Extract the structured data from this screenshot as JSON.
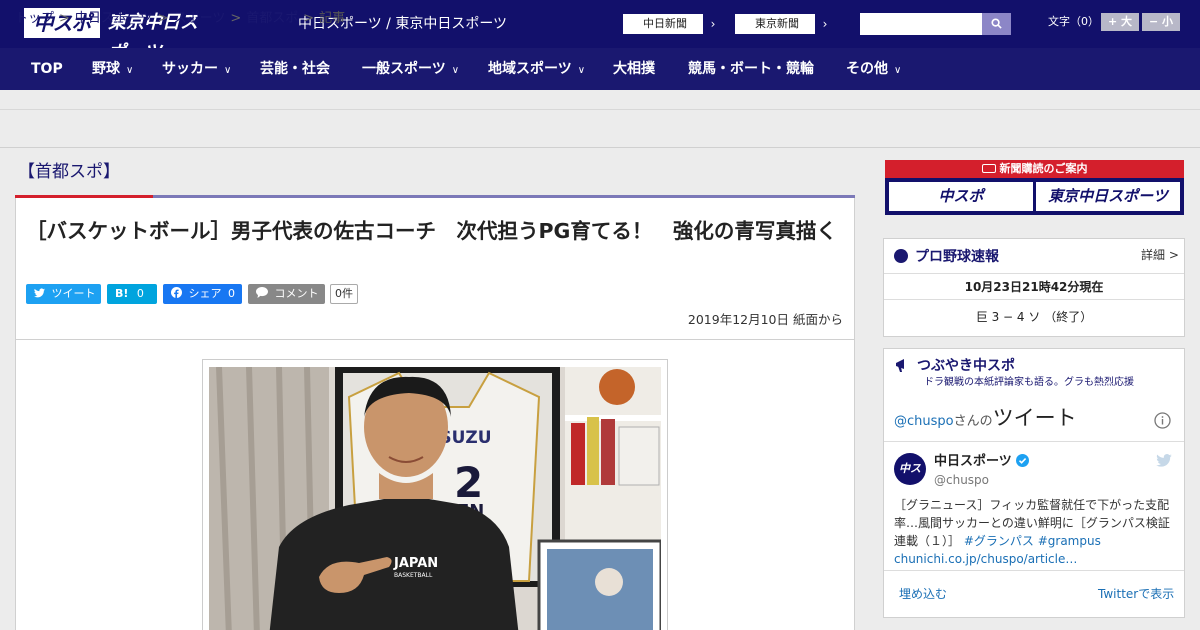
{
  "header": {
    "logo_main": "中スポ",
    "logo_tokyo": "東京中日スポーツ",
    "site_subtitle": "中日スポーツ / 東京中日スポーツ",
    "link_chunichi": "中日新聞",
    "link_tokyo": "東京新聞",
    "link_arrow": "›",
    "search_placeholder": "",
    "fontsize_label": "文字（0）",
    "fontsize_up": "+ 大",
    "fontsize_down": "− 小"
  },
  "nav": {
    "items": [
      {
        "label": "TOP",
        "chevron": ""
      },
      {
        "label": "野球",
        "chevron": "∨"
      },
      {
        "label": "サッカー",
        "chevron": "∨"
      },
      {
        "label": "芸能・社会",
        "chevron": ""
      },
      {
        "label": "一般スポーツ",
        "chevron": "∨"
      },
      {
        "label": "地域スポーツ",
        "chevron": "∨"
      },
      {
        "label": "大相撲",
        "chevron": ""
      },
      {
        "label": "競馬・ボート・競輪",
        "chevron": ""
      },
      {
        "label": "その他",
        "chevron": "∨"
      }
    ]
  },
  "breadcrumb": {
    "items": [
      "トップ",
      "中日スポーツ",
      "スポーツ",
      "首都スポ",
      "記事"
    ],
    "separator": ">"
  },
  "section_title": "【首都スポ】",
  "article": {
    "headline": "［バスケットボール］男子代表の佐古コーチ　次代担うPG育てる！　強化の青写真描く",
    "share": {
      "tweet": "ツイート",
      "hatena": "B!",
      "hatena_count": "0",
      "facebook": "シェア",
      "facebook_count": "0",
      "comment": "コメント",
      "comment_count": "0件"
    },
    "date": "2019年12月10日 紙面から",
    "photo_labels": {
      "jersey": "ISUZU",
      "jersey_number": "2",
      "jersey_name": "EN",
      "hoodie": "JAPAN",
      "hoodie_sub": "BASKETBALL"
    }
  },
  "sidebar": {
    "promo": {
      "title": "新聞購読のご案内",
      "logo_main": "中スポ",
      "logo_tokyo": "東京中日スポーツ"
    },
    "baseball": {
      "title": "プロ野球速報",
      "more": "詳細 >",
      "time": "10月23日21時42分現在",
      "score": "巨 3 − 4 ソ （終了）"
    },
    "tweets": {
      "title": "つぶやき中スポ",
      "subtitle": "ドラ観戦の本紙評論家も語る。グラも熱烈応援",
      "header_handle": "@chuspo",
      "header_san": "さんの",
      "header_tweet": "ツイート",
      "account_name": "中日スポーツ",
      "account_handle": "@chuspo",
      "avatar_text": "中スポ",
      "body_text": "［グラニュース］フィッカ監督就任で下がった支配率…風間サッカーとの違い鮮明に［グランパス検証連載（１）］",
      "tags": "#グランパス #grampus",
      "link": "chunichi.co.jp/chuspo/article…",
      "embed": "埋め込む",
      "view_on": "Twitterで表示"
    }
  },
  "colors": {
    "navy": "#12106b",
    "red": "#d41f2c",
    "twitter": "#1da1f2",
    "facebook": "#1877f2",
    "hatena": "#00a4de"
  }
}
